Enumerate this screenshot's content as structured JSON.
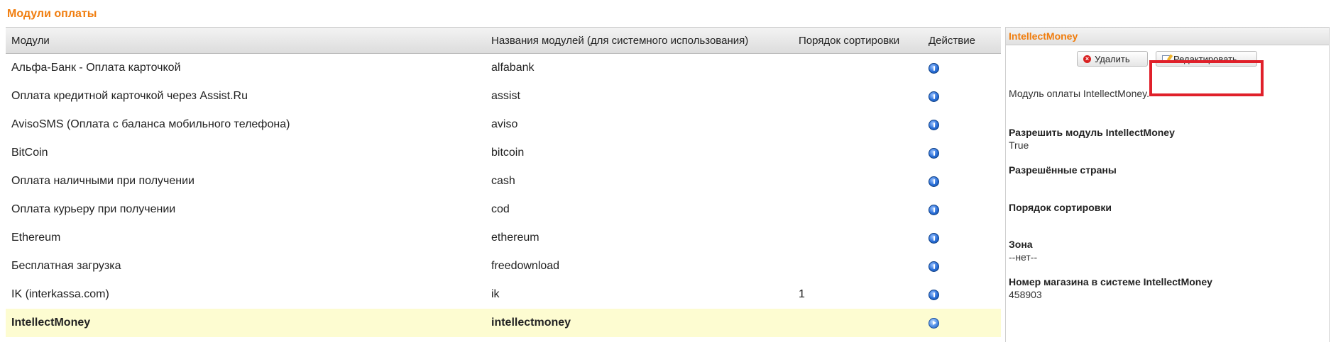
{
  "page": {
    "title": "Модули оплаты"
  },
  "table": {
    "columns": [
      "Модули",
      "Названия модулей (для системного использования)",
      "Порядок сортировки",
      "Действие"
    ],
    "rows": [
      {
        "name": "Альфа-Банк - Оплата карточкой",
        "code": "alfabank",
        "sort": "",
        "action_icon": "info-icon"
      },
      {
        "name": "Оплата кредитной карточкой через Assist.Ru",
        "code": "assist",
        "sort": "",
        "action_icon": "info-icon"
      },
      {
        "name": "AvisoSMS (Оплата с баланса мобильного телефона)",
        "code": "aviso",
        "sort": "",
        "action_icon": "info-icon"
      },
      {
        "name": "BitCoin",
        "code": "bitcoin",
        "sort": "",
        "action_icon": "info-icon"
      },
      {
        "name": "Оплата наличными при получении",
        "code": "cash",
        "sort": "",
        "action_icon": "info-icon"
      },
      {
        "name": "Оплата курьеру при получении",
        "code": "cod",
        "sort": "",
        "action_icon": "info-icon"
      },
      {
        "name": "Ethereum",
        "code": "ethereum",
        "sort": "",
        "action_icon": "info-icon"
      },
      {
        "name": "Бесплатная загрузка",
        "code": "freedownload",
        "sort": "",
        "action_icon": "info-icon"
      },
      {
        "name": "IK (interkassa.com)",
        "code": "ik",
        "sort": "1",
        "action_icon": "info-icon"
      },
      {
        "name": "IntellectMoney",
        "code": "intellectmoney",
        "sort": "",
        "action_icon": "arrow-icon",
        "selected": true
      }
    ]
  },
  "panel": {
    "title": "IntellectMoney",
    "delete_label": "Удалить",
    "edit_label": "Редактировать",
    "description": "Модуль оплаты IntellectMoney.",
    "fields": [
      {
        "label": "Разрешить модуль IntellectMoney",
        "value": "True"
      },
      {
        "label": "Разрешённые страны",
        "value": ""
      },
      {
        "label": "Порядок сортировки",
        "value": ""
      },
      {
        "label": "Зона",
        "value": "--нет--"
      },
      {
        "label": "Номер магазина в системе IntellectMoney",
        "value": "458903"
      }
    ]
  },
  "colors": {
    "accent": "#f07d0e",
    "selected_row": "#fdfcd1",
    "highlight": "#e0202a"
  }
}
